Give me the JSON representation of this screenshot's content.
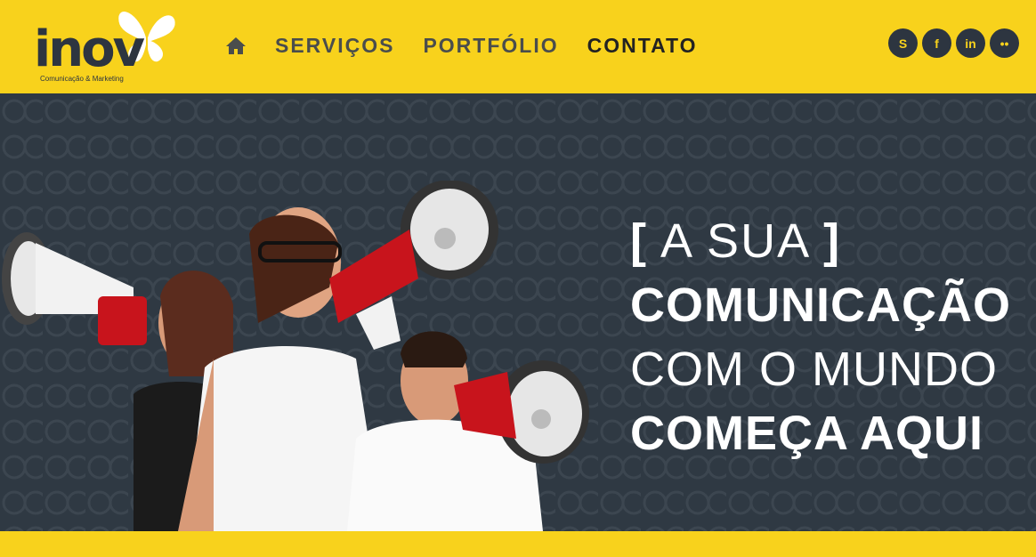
{
  "brand": {
    "logo_text": "inov",
    "tagline": "Comunicação & Marketing",
    "accent_color": "#f8d21c",
    "dark_color": "#2f3943"
  },
  "nav": {
    "home_icon": "home-icon",
    "items": [
      {
        "label": "SERVIÇOS"
      },
      {
        "label": "PORTFÓLIO"
      },
      {
        "label": "CONTATO"
      }
    ]
  },
  "social": [
    {
      "icon": "skype-icon",
      "glyph": "S"
    },
    {
      "icon": "facebook-icon",
      "glyph": "f"
    },
    {
      "icon": "linkedin-icon",
      "glyph": "in"
    },
    {
      "icon": "flickr-icon",
      "glyph": "••"
    }
  ],
  "hero": {
    "bracket_open": "[",
    "line1": " A SUA ",
    "bracket_close": "]",
    "line2": "COMUNICAÇÃO",
    "line3": "COM O MUNDO",
    "line4": "COMEÇA AQUI"
  }
}
